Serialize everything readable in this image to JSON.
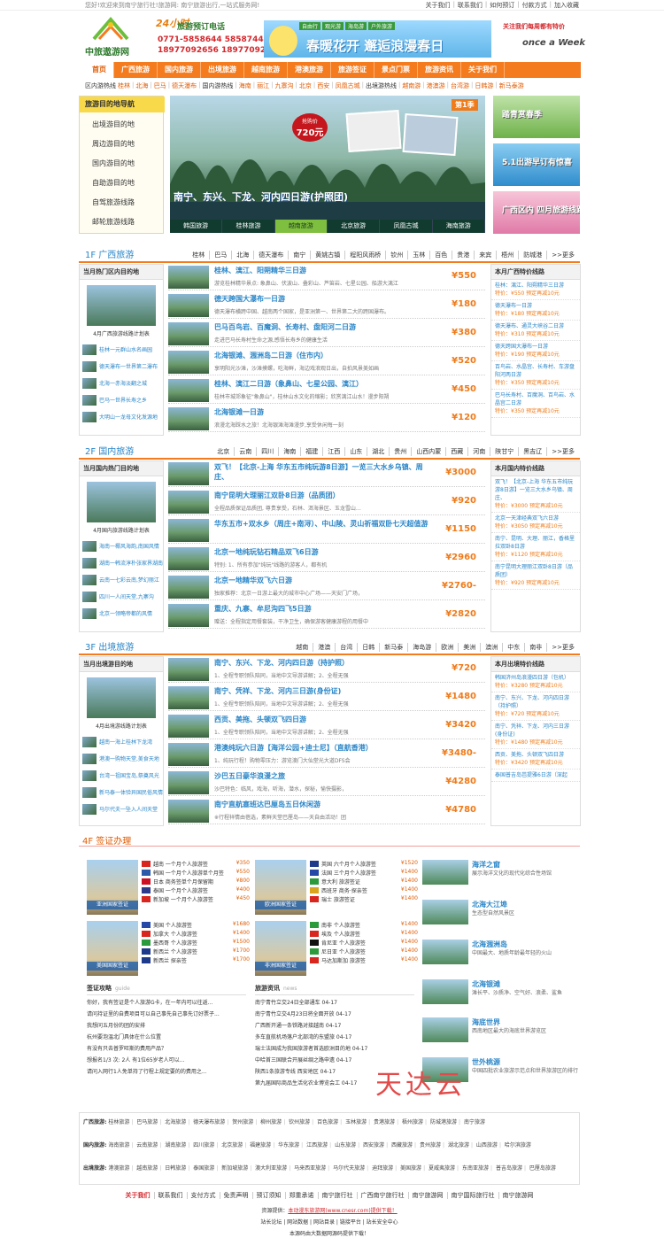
{
  "topbar": {
    "welcome": "您好!欢迎来到南宁旅行社!旅游网: 南宁旅游出行,一站式服务网!",
    "links": [
      "关于我们",
      "联系我们",
      "如何预订",
      "付款方式",
      "加入收藏"
    ]
  },
  "header": {
    "logo_text": "中旅遨游网",
    "badge": "24小时",
    "service_title": "旅游预订电话",
    "phone1": "0771-5858644 5858744",
    "phone2": "18977092656 18977092386",
    "banner_text": "春暖花开 邂逅浪漫春日",
    "banner_tabs": [
      "自由行",
      "观光游",
      "海岛游",
      "户外旅游"
    ],
    "week_title": "关注我们每周都有特价",
    "week_brand": "once a Week"
  },
  "nav": [
    "首页",
    "广西旅游",
    "国内旅游",
    "出境旅游",
    "越南旅游",
    "港澳旅游",
    "旅游签证",
    "景点门票",
    "旅游资讯",
    "关于我们"
  ],
  "subnav": {
    "label1": "区内游热线",
    "items1": [
      "桂林",
      "北海",
      "巴马",
      "德天瀑布"
    ],
    "label2": "国内游热线",
    "items2": [
      "海南",
      "丽江",
      "九寨沟",
      "北京",
      "西安",
      "凤凰古城"
    ],
    "label3": "出境游热线",
    "items3": [
      "越南游",
      "港澳游",
      "台湾游",
      "日韩游",
      "新马泰游"
    ]
  },
  "dest": {
    "title": "旅游目的地导航",
    "items": [
      "出境游目的地",
      "周边游目的地",
      "国内游目的地",
      "自助游目的地",
      "自驾旅游线路",
      "邮轮旅游线路"
    ]
  },
  "hero": {
    "price_label": "抢购价",
    "price": "720元",
    "season": "第1季",
    "caption": "南宁、东兴、下龙、河内四日游(护照团)",
    "tabs": [
      "韩国旅游",
      "桂林旅游",
      "越南旅游",
      "北京旅游",
      "凤凰古城",
      "海南旅游"
    ]
  },
  "side_ads": [
    "踏青赏春季",
    "5.1出游早订有惊喜",
    "广西区内 四月旅游线路"
  ],
  "sec1": {
    "title": "1F 广西旅游",
    "cities": [
      "桂林",
      "巴马",
      "北海",
      "德天瀑布",
      "南宁",
      "黄姚古镇",
      "程阳风雨桥",
      "钦州",
      "玉林",
      "百色",
      "贵港",
      "来宾",
      "梧州",
      "防城港",
      ">>更多"
    ],
    "left_head": "当月热门区内目的地",
    "left_cap": "4月广西旅游线路计划表",
    "left_list": [
      "桂林一元群山水名画园",
      "德天瀑布一世界第二瀑布",
      "北海一赤海淡翻之城",
      "巴马一世界长寿之乡",
      "大明山一龙母文化发源地"
    ],
    "items": [
      {
        "title": "桂林、漓江、阳朔精华三日游",
        "desc": "游览桂林精华景点: 象鼻山、伏波山、叠彩山、芦笛岩、七星公园、船游大漓江",
        "price": "¥550"
      },
      {
        "title": "德天跨国大瀑布一日游",
        "desc": "德天瀑布横跨中国、越南两个国家，是亚洲第一、世界第二大的跨国瀑布。",
        "price": "¥180"
      },
      {
        "title": "巴马百鸟岩、百魔洞、长寿村、盘阳河二日游",
        "desc": "走进巴马长寿村生命之源,感悟长寿乡的健康生活",
        "price": "¥380"
      },
      {
        "title": "北海银滩、涠洲岛二日游（住市内）",
        "desc": "享明阳光沙滩，沙滩摸螺，吃海鲜，海边戏浪观日出，自拍风景美如画",
        "price": "¥520"
      },
      {
        "title": "桂林、漓江二日游（象鼻山、七星公园、漓江）",
        "desc": "桂林市城郊象征\"象鼻山\"，桂林山水文化的缩影；欣赏漓江山水！漫步阳朔",
        "price": "¥450"
      },
      {
        "title": "北海银滩一日游",
        "desc": "浪漫北海踩水之旅！北海银滩海滩漫步,享受休闲每一刻",
        "price": "¥120"
      }
    ],
    "right_head": "本月广西特价线路",
    "right_items": [
      {
        "name": "桂林：漓江、阳朔精华三日游",
        "sale": "特价：¥550 预定再减10元"
      },
      {
        "name": "德天瀑布一日游",
        "sale": "特价：¥180 预定再减10元"
      },
      {
        "name": "德天瀑布、通灵大峡谷二日游",
        "sale": "特价：¥310 预定再减10元"
      },
      {
        "name": "德天跨国大瀑布一日游",
        "sale": "特价：¥190 预定再减10元"
      },
      {
        "name": "百鸟岩、水晶宫、长寿村、车游盘阳河两日游",
        "sale": "特价：¥350 预定再减10元"
      },
      {
        "name": "巴马长寿村、百魔洞、百鸟岩、水晶宫二日游",
        "sale": "特价：¥350 预定再减10元"
      }
    ]
  },
  "sec2": {
    "title": "2F 国内旅游",
    "cities": [
      "北京",
      "云南",
      "四川",
      "海南",
      "福建",
      "江西",
      "山东",
      "湖北",
      "贵州",
      "山西内蒙",
      "西藏",
      "河南",
      "陕甘宁",
      "黑吉辽",
      ">>更多"
    ],
    "left_head": "当月国内热门目的地",
    "left_cap": "4月国内旅游线路计划表",
    "left_list": [
      "海南一椰风海韵,南国风情",
      "湖南一韩流淳朴张家界湖南",
      "云南一七彩云南,梦幻丽江",
      "四川一人间天堂,九寨沟",
      "北京一领略帝都的风情"
    ],
    "items": [
      {
        "title": "双飞！【北京-上海 华东五市纯玩游8日游】一览三大水乡乌镇、周庄、",
        "desc": "",
        "price": "¥3000"
      },
      {
        "title": "南宁昆明大理丽江双卧8日游（品质团）",
        "desc": "全程品质保证品质团, 尊贵享受，石林、洱海景区、玉龙雪山…",
        "price": "¥920"
      },
      {
        "title": "华东五市+双水乡（周庄+南浔）、中山陵、灵山祈福双卧七天超值游",
        "desc": "",
        "price": "¥1150"
      },
      {
        "title": "北京一地纯玩钻石精品双飞6日游",
        "desc": "特别:  1、所有参加\"纯玩\"线路的游客人，都有机",
        "price": "¥2960"
      },
      {
        "title": "北京一地精华双飞六日游",
        "desc": "独家推荐：北京一日游上最大的城市中心广场——天安门广场，",
        "price": "¥2760-"
      },
      {
        "title": "重庆、九寨、牟尼沟四飞5日游",
        "desc": "赠送：全程指定用餐套装，干净卫生，确保游客健康游程的用餐中",
        "price": "¥2820"
      }
    ],
    "right_head": "本月国内特价线路",
    "right_items": [
      {
        "name": "双飞！【北京-上海 华东五市纯玩游8日游】一览三大水乡乌镇、周庄、",
        "sale": "特价：¥3000 预定再减10元"
      },
      {
        "name": "北京一天津经典双飞六日游",
        "sale": "特价：¥3050 预定再减10元"
      },
      {
        "name": "南宁、昆明、大理、丽江，香格里拉双卧8日游",
        "sale": "特价：¥1120 预定再减10元"
      },
      {
        "name": "南宁昆明大理丽江双卧8日游（品质团）",
        "sale": "特价：¥920 预定再减10元"
      }
    ]
  },
  "sec3": {
    "title": "3F 出境旅游",
    "cities": [
      "越南",
      "港澳",
      "台湾",
      "日韩",
      "新马泰",
      "海岛游",
      "欧洲",
      "美洲",
      "澳洲",
      "中东",
      "南非",
      ">>更多"
    ],
    "left_head": "当月出境游目的地",
    "left_cap": "4月出境游线路计划表",
    "left_list": [
      "越南一海上桂林下龙湾",
      "港澳一购物天堂,美食天地",
      "台湾一祖国宝岛,祭奠风光",
      "新马泰一体验异国民俗风情",
      "马尔代夫一坠入人间天堂"
    ],
    "items": [
      {
        "title": "南宁、东兴、下龙、河内四日游（持护照）",
        "desc": "1、全程专职领队陪同，当地中文导游讲解；2、全程无强",
        "price": "¥720"
      },
      {
        "title": "南宁、凭祥、下龙、河内三日游(身份证)",
        "desc": "1、全程专职领队陪同，当地中文导游讲解；2、全程无强",
        "price": "¥1480"
      },
      {
        "title": "西贡、美拖、头顿双飞四日游",
        "desc": "1、全程专职领队陪同，当地中文导游讲解；2、全程无强",
        "price": "¥3420"
      },
      {
        "title": "港澳纯玩六日游【海洋公园+迪士尼】（直航香港）",
        "desc": "1、纯玩行程！购物零压力：游览澳门大仙堂光大道DFS会",
        "price": "¥3480-"
      },
      {
        "title": "沙巴五日豪华浪漫之旅",
        "desc": "沙巴特色：临风，戏海，听海，潜水，探秘，愉快摄影，",
        "price": "¥4280"
      },
      {
        "title": "南宁直航塞班达巴厘岛五日休闲游",
        "desc": "※行程祥情由蓓选，素鲜天堂巴厘岛——天自由活动！团",
        "price": "¥4780"
      }
    ],
    "right_head": "本月出境特价线路",
    "right_items": [
      {
        "name": "韩国济州岛浪漫四日游（包机）",
        "sale": "特价：¥3280 预定再减10元"
      },
      {
        "name": "南宁、东兴、下龙、河内四日游（持护照）",
        "sale": "特价：¥720 预定再减10元"
      },
      {
        "name": "南宁、凭祥、下龙、河内三日游(身份证)",
        "sale": "特价：¥1480 预定再减10元"
      },
      {
        "name": "西贡、美拖、头顿双飞四日游",
        "sale": "特价：¥3420 预定再减10元"
      },
      {
        "name": "泰国普吉岛芭提雅6日游（深起",
        "sale": ""
      }
    ]
  },
  "visa": {
    "title": "4F 签证办理",
    "asia_label": "亚洲国家签证",
    "europe_label": "欧洲国家签证",
    "america_label": "美国国家签证",
    "africa_label": "非洲国家签证",
    "asia": [
      {
        "name": "越南 一个月个人旅游签",
        "price": "¥350",
        "color": "#d8251d"
      },
      {
        "name": "韩国 一个月个人旅游单个月签",
        "price": "¥550",
        "color": "#2a5aa8"
      },
      {
        "name": "日本 商务签单个月保留期",
        "price": "¥800",
        "color": "#cc1122"
      },
      {
        "name": "泰国 一个月个人旅游签",
        "price": "¥400",
        "color": "#2d3a8c"
      },
      {
        "name": "新加坡 一个月个人旅游签",
        "price": "¥450",
        "color": "#d8251d"
      }
    ],
    "europe": [
      {
        "name": "英国 六个月个人旅游签",
        "price": "¥1520",
        "color": "#1e3a8a"
      },
      {
        "name": "法国 三个月个人旅游签",
        "price": "¥1400",
        "color": "#2848a8"
      },
      {
        "name": "意大利 旅游签证",
        "price": "¥1400",
        "color": "#2a9a3a"
      },
      {
        "name": "西班牙 商务·探亲签",
        "price": "¥1400",
        "color": "#d8a51d"
      },
      {
        "name": "瑞士 旅游签证",
        "price": "¥1400",
        "color": "#d8251d"
      }
    ],
    "america": [
      {
        "name": "美国 个人旅游签",
        "price": "¥1680",
        "color": "#2848a8"
      },
      {
        "name": "加拿大 个人旅游签",
        "price": "¥1400",
        "color": "#d8251d"
      },
      {
        "name": "墨西哥 个人旅游签",
        "price": "¥1500",
        "color": "#2a9a3a"
      },
      {
        "name": "新西兰 个人旅游签",
        "price": "¥1700",
        "color": "#1e3a8a"
      },
      {
        "name": "新西兰 探亲签",
        "price": "¥1700",
        "color": "#1e3a8a"
      }
    ],
    "africa": [
      {
        "name": "南非 个人旅游签",
        "price": "¥1400",
        "color": "#2a9a3a"
      },
      {
        "name": "埃及 个人旅游签",
        "price": "¥1400",
        "color": "#d8251d"
      },
      {
        "name": "肯尼亚 个人旅游签",
        "price": "¥1400",
        "color": "#111111"
      },
      {
        "name": "尼日亚 个人旅游签",
        "price": "¥1400",
        "color": "#2a9a3a"
      },
      {
        "name": "马达加斯加 旅游签",
        "price": "¥1400",
        "color": "#d8251d"
      }
    ]
  },
  "spots": [
    {
      "title": "海洋之窗",
      "desc": "展示海洋文化的现代化综合性场馆"
    },
    {
      "title": "北海大江埠",
      "desc": "生态型自然风景区"
    },
    {
      "title": "北海涠洲岛",
      "desc": "中国最大、地质年龄最年轻的火山"
    },
    {
      "title": "北海银滩",
      "desc": "滩长平、沙质净、空气好、浪柔、鲨鱼"
    },
    {
      "title": "海底世界",
      "desc": "西南地区最大的海底世界游览区"
    },
    {
      "title": "世外桃源",
      "desc": "中国四批农业旅游示范点和世界旅游区的排行"
    }
  ],
  "guide": {
    "title": "签证攻略",
    "tag": "guide",
    "items": [
      "你好，我有签证是个人旅游G卡，在一年内可以往返...",
      "请问持证里的自费项目可以自己事先自己事先订好票子...",
      "我想问五月份的团的安排",
      "杭州要泡温北门具体在什么位置",
      "有没有只去普罗旺斯的费用产品？",
      "想报名1/3 次: 2人 有1位65岁老人可以...",
      "请问入网行1人免单持了行程上规定要的的费用之..."
    ]
  },
  "news": {
    "title": "旅游资讯",
    "tag": "news",
    "items": [
      "南宁青竹立交24日全部通车 04-17",
      "南宁青竹立交4月23日将全面开放 04-17",
      "广西新开通一条铁路对接越南 04-17",
      "多车直航机场落户北部湾的东盟旅 04-17",
      "瑞士法国成为我国旅游者首选欧洲目的地 04-17",
      "中哈首三国联合开展丝绸之路申遗 04-17",
      "陕西1条旅游专线 西安地区 04-17",
      "第九届国际商品生活化农业博览会工 04-17"
    ]
  },
  "watermark": "天达云",
  "links": {
    "gx_label": "广西旅游:",
    "gx": [
      "桂林旅游",
      "巴马旅游",
      "北海旅游",
      "德天瀑布旅游",
      "贺州旅游",
      "柳州旅游",
      "钦州旅游",
      "百色旅游",
      "玉林旅游",
      "贵港旅游",
      "梧州旅游",
      "防城港旅游",
      "南宁旅游"
    ],
    "gn_label": "国内旅游:",
    "gn": [
      "海南旅游",
      "云南旅游",
      "湖南旅游",
      "四川旅游",
      "北京旅游",
      "福建旅游",
      "华东旅游",
      "江西旅游",
      "山东旅游",
      "西安旅游",
      "西藏旅游",
      "贵州旅游",
      "湖北旅游",
      "山西旅游",
      "哈尔滨旅游"
    ],
    "cj_label": "出境旅游:",
    "cj": [
      "港澳旅游",
      "越南旅游",
      "日韩旅游",
      "泰国旅游",
      "新加坡旅游",
      "澳大利亚旅游",
      "马来西亚旅游",
      "马尔代夫旅游",
      "迪拜旅游",
      "美国旅游",
      "夏威夷旅游",
      "东南亚旅游",
      "普吉岛旅游",
      "巴厘岛旅游"
    ]
  },
  "footer": {
    "nav": [
      "关于我们",
      "联系我们",
      "支付方式",
      "免责声明",
      "预订须知",
      "郑重承诺",
      "南宁旅行社",
      "广西南宁旅行社",
      "南宁旅游网",
      "南宁国际旅行社",
      "南宁旅游网"
    ],
    "line1_prefix": "资源提供：",
    "line1_link": "本动漫东旅游网(www.cnesr.com)提供下载！",
    "line2": "站长论坛 | 网站数据 | 网站目录 | 链接平台 | 站长安全中心",
    "line3": "本源码由大数据网源码提供下载！"
  }
}
